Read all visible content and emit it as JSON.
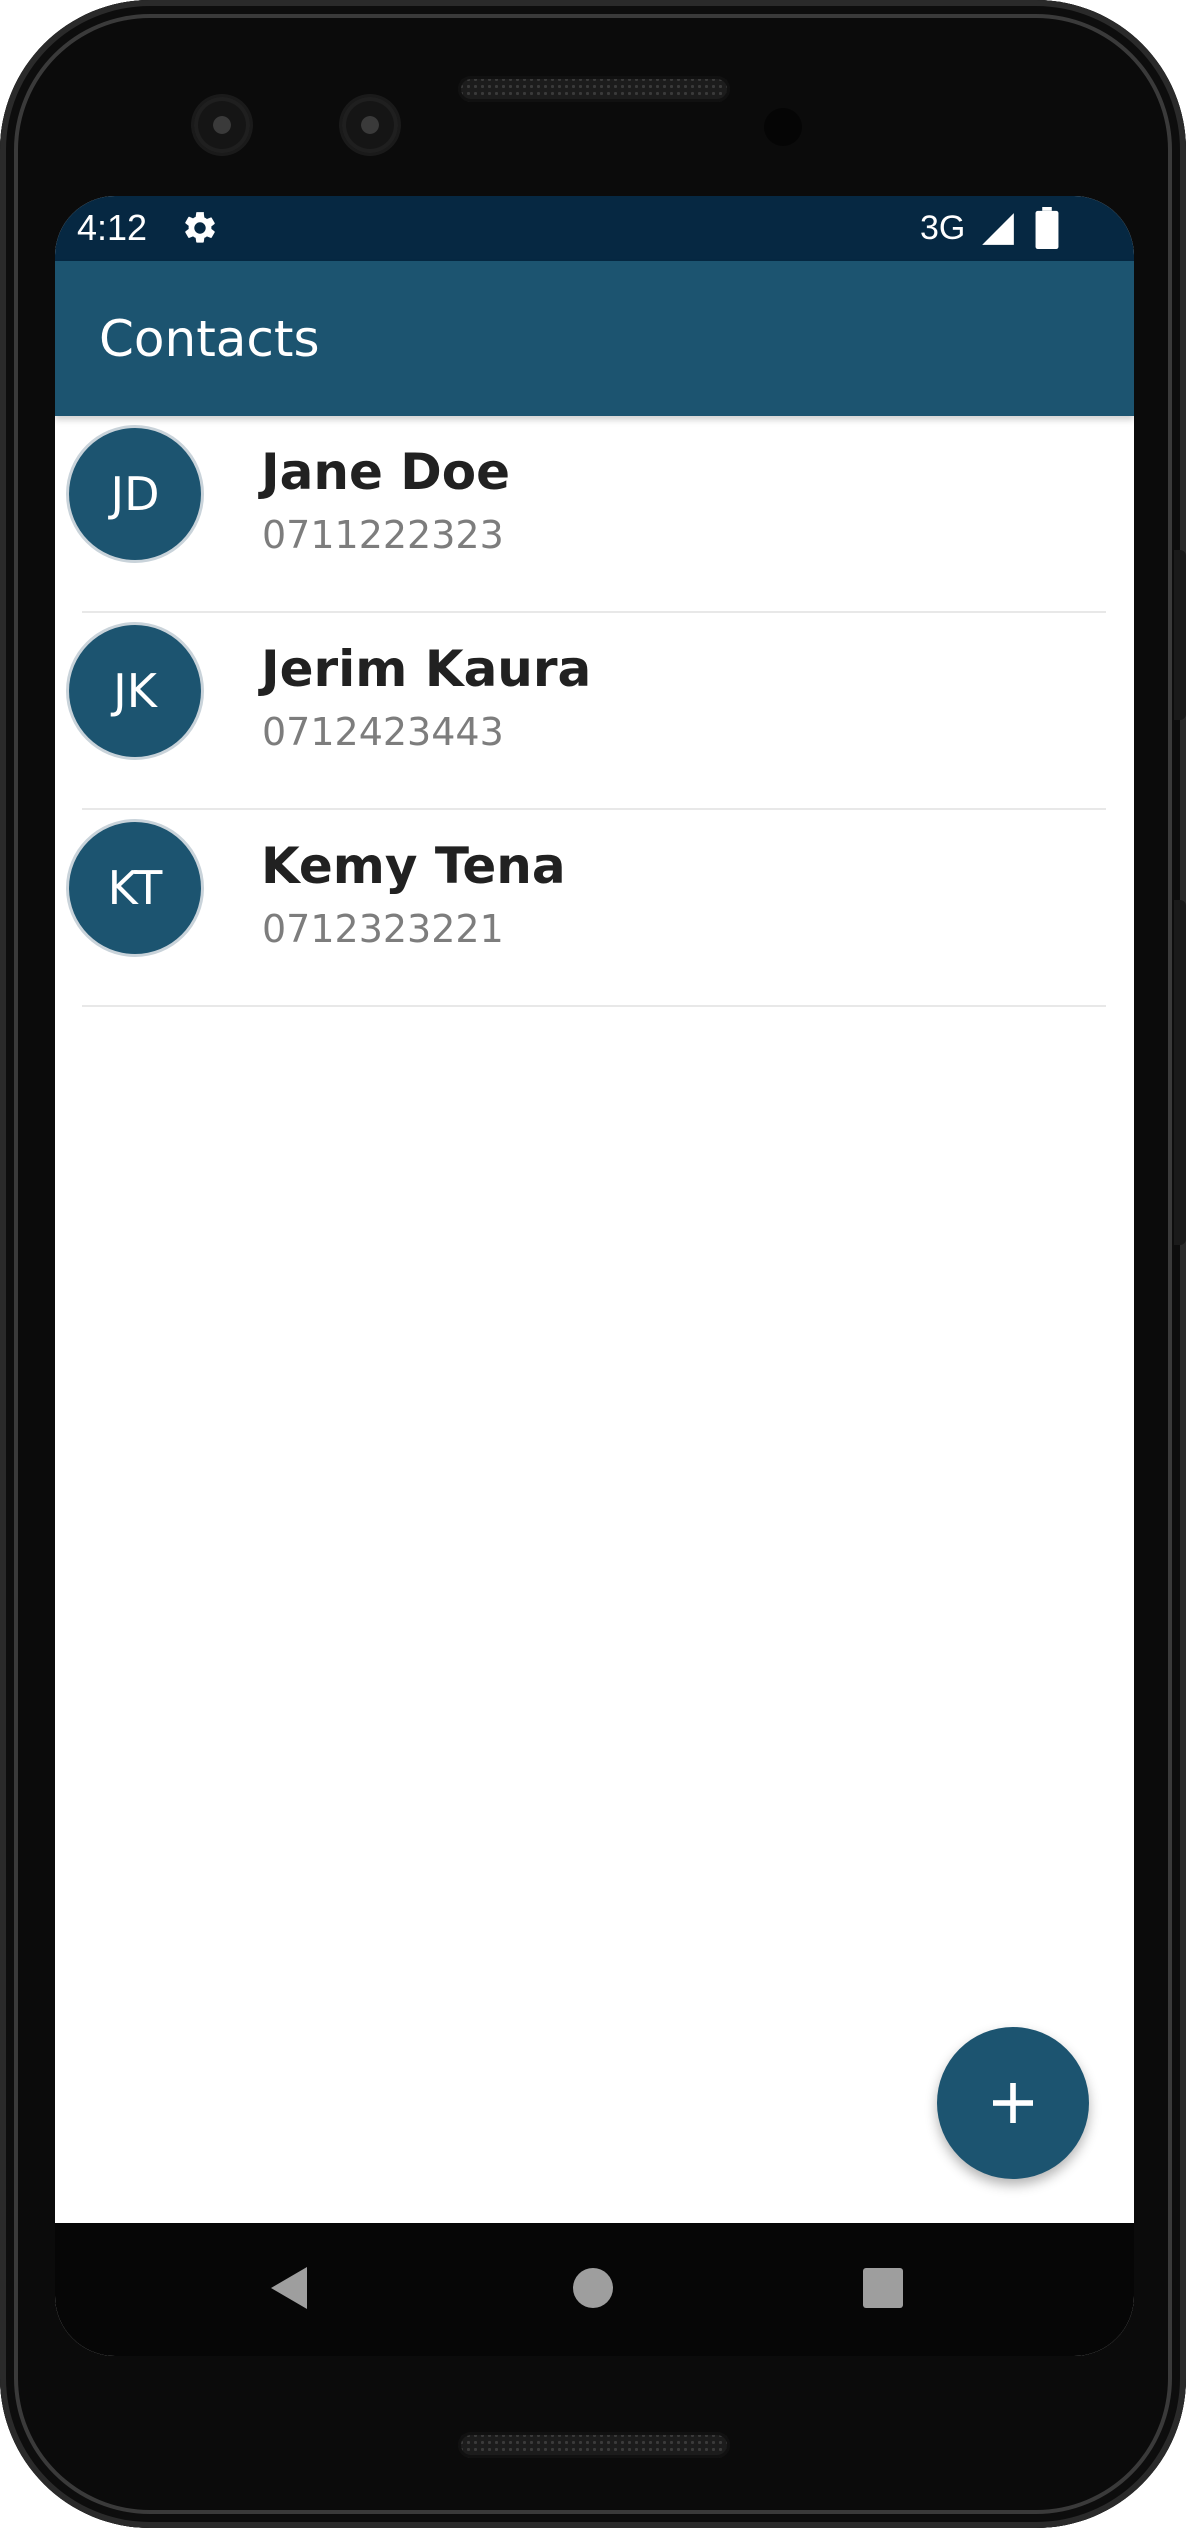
{
  "status_bar": {
    "time": "4:12",
    "network": "3G",
    "icons": [
      "gear-icon",
      "signal-icon",
      "battery-icon"
    ],
    "background_color": "#062842"
  },
  "app_bar": {
    "title": "Contacts",
    "background_color": "#1c5470"
  },
  "contacts": [
    {
      "initials": "JD",
      "name": "Jane Doe",
      "phone": "0711222323"
    },
    {
      "initials": "JK",
      "name": "Jerim Kaura",
      "phone": "0712423443"
    },
    {
      "initials": "KT",
      "name": "Kemy Tena",
      "phone": "0712323221"
    }
  ],
  "fab": {
    "icon": "plus-icon",
    "color": "#1c5470"
  },
  "nav_bar": {
    "buttons": [
      "back-icon",
      "home-icon",
      "recents-icon"
    ]
  }
}
